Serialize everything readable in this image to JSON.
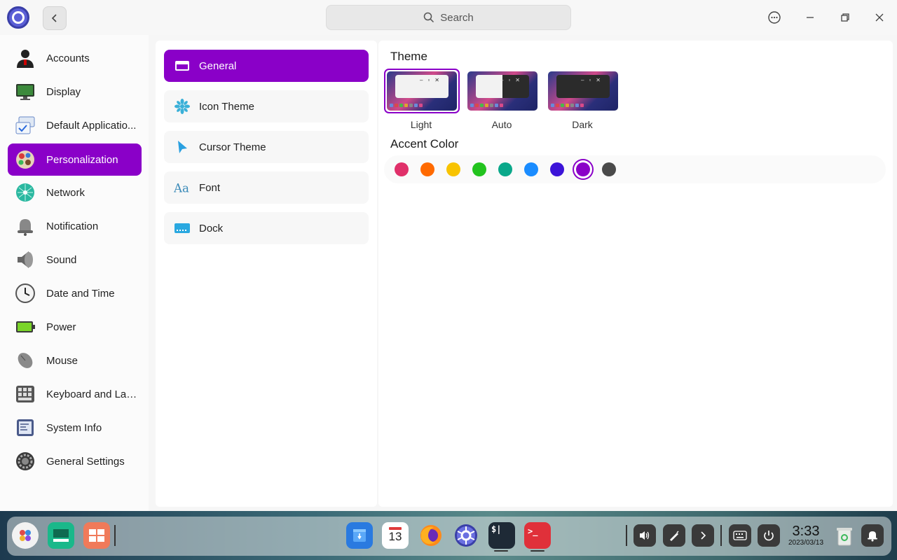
{
  "titlebar": {
    "search_placeholder": "Search"
  },
  "sidebar": {
    "items": [
      {
        "label": "Accounts",
        "icon": "account-icon"
      },
      {
        "label": "Display",
        "icon": "display-icon"
      },
      {
        "label": "Default Applicatio...",
        "icon": "default-apps-icon"
      },
      {
        "label": "Personalization",
        "icon": "personalization-icon",
        "active": true
      },
      {
        "label": "Network",
        "icon": "network-icon"
      },
      {
        "label": "Notification",
        "icon": "notification-bell-icon"
      },
      {
        "label": "Sound",
        "icon": "speaker-icon"
      },
      {
        "label": "Date and Time",
        "icon": "clock-icon"
      },
      {
        "label": "Power",
        "icon": "battery-icon"
      },
      {
        "label": "Mouse",
        "icon": "mouse-icon"
      },
      {
        "label": "Keyboard and Lan...",
        "icon": "keyboard-icon"
      },
      {
        "label": "System Info",
        "icon": "system-info-icon"
      },
      {
        "label": "General Settings",
        "icon": "gear-icon"
      }
    ]
  },
  "subnav": {
    "items": [
      {
        "label": "General",
        "icon": "window-icon",
        "active": true
      },
      {
        "label": "Icon Theme",
        "icon": "snowflake-icon"
      },
      {
        "label": "Cursor Theme",
        "icon": "cursor-icon"
      },
      {
        "label": "Font",
        "icon": "font-icon"
      },
      {
        "label": "Dock",
        "icon": "dock-icon"
      }
    ]
  },
  "content": {
    "theme_title": "Theme",
    "themes": [
      {
        "label": "Light",
        "selected": true
      },
      {
        "label": "Auto",
        "selected": false
      },
      {
        "label": "Dark",
        "selected": false
      }
    ],
    "accent_title": "Accent Color",
    "accent_colors": [
      "#e0306a",
      "#ff6a00",
      "#f8c300",
      "#22c31e",
      "#0aa88a",
      "#1a8cff",
      "#3c14d8",
      "#8a00c8",
      "#4a4a4a"
    ],
    "accent_selected": "#8a00c8"
  },
  "dock": {
    "clock_time": "3:33",
    "clock_date": "2023/03/13",
    "calendar_day": "13"
  },
  "colors": {
    "accent": "#8a00c8"
  }
}
